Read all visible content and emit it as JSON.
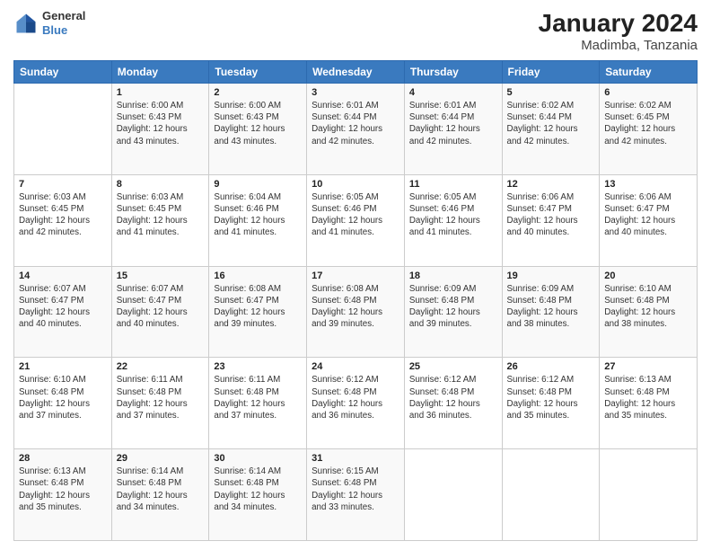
{
  "header": {
    "title": "January 2024",
    "subtitle": "Madimba, Tanzania",
    "logo_general": "General",
    "logo_blue": "Blue"
  },
  "weekdays": [
    "Sunday",
    "Monday",
    "Tuesday",
    "Wednesday",
    "Thursday",
    "Friday",
    "Saturday"
  ],
  "weeks": [
    [
      {
        "day": "",
        "sunrise": "",
        "sunset": "",
        "daylight": ""
      },
      {
        "day": "1",
        "sunrise": "Sunrise: 6:00 AM",
        "sunset": "Sunset: 6:43 PM",
        "daylight": "Daylight: 12 hours and 43 minutes."
      },
      {
        "day": "2",
        "sunrise": "Sunrise: 6:00 AM",
        "sunset": "Sunset: 6:43 PM",
        "daylight": "Daylight: 12 hours and 43 minutes."
      },
      {
        "day": "3",
        "sunrise": "Sunrise: 6:01 AM",
        "sunset": "Sunset: 6:44 PM",
        "daylight": "Daylight: 12 hours and 42 minutes."
      },
      {
        "day": "4",
        "sunrise": "Sunrise: 6:01 AM",
        "sunset": "Sunset: 6:44 PM",
        "daylight": "Daylight: 12 hours and 42 minutes."
      },
      {
        "day": "5",
        "sunrise": "Sunrise: 6:02 AM",
        "sunset": "Sunset: 6:44 PM",
        "daylight": "Daylight: 12 hours and 42 minutes."
      },
      {
        "day": "6",
        "sunrise": "Sunrise: 6:02 AM",
        "sunset": "Sunset: 6:45 PM",
        "daylight": "Daylight: 12 hours and 42 minutes."
      }
    ],
    [
      {
        "day": "7",
        "sunrise": "Sunrise: 6:03 AM",
        "sunset": "Sunset: 6:45 PM",
        "daylight": "Daylight: 12 hours and 42 minutes."
      },
      {
        "day": "8",
        "sunrise": "Sunrise: 6:03 AM",
        "sunset": "Sunset: 6:45 PM",
        "daylight": "Daylight: 12 hours and 41 minutes."
      },
      {
        "day": "9",
        "sunrise": "Sunrise: 6:04 AM",
        "sunset": "Sunset: 6:46 PM",
        "daylight": "Daylight: 12 hours and 41 minutes."
      },
      {
        "day": "10",
        "sunrise": "Sunrise: 6:05 AM",
        "sunset": "Sunset: 6:46 PM",
        "daylight": "Daylight: 12 hours and 41 minutes."
      },
      {
        "day": "11",
        "sunrise": "Sunrise: 6:05 AM",
        "sunset": "Sunset: 6:46 PM",
        "daylight": "Daylight: 12 hours and 41 minutes."
      },
      {
        "day": "12",
        "sunrise": "Sunrise: 6:06 AM",
        "sunset": "Sunset: 6:47 PM",
        "daylight": "Daylight: 12 hours and 40 minutes."
      },
      {
        "day": "13",
        "sunrise": "Sunrise: 6:06 AM",
        "sunset": "Sunset: 6:47 PM",
        "daylight": "Daylight: 12 hours and 40 minutes."
      }
    ],
    [
      {
        "day": "14",
        "sunrise": "Sunrise: 6:07 AM",
        "sunset": "Sunset: 6:47 PM",
        "daylight": "Daylight: 12 hours and 40 minutes."
      },
      {
        "day": "15",
        "sunrise": "Sunrise: 6:07 AM",
        "sunset": "Sunset: 6:47 PM",
        "daylight": "Daylight: 12 hours and 40 minutes."
      },
      {
        "day": "16",
        "sunrise": "Sunrise: 6:08 AM",
        "sunset": "Sunset: 6:47 PM",
        "daylight": "Daylight: 12 hours and 39 minutes."
      },
      {
        "day": "17",
        "sunrise": "Sunrise: 6:08 AM",
        "sunset": "Sunset: 6:48 PM",
        "daylight": "Daylight: 12 hours and 39 minutes."
      },
      {
        "day": "18",
        "sunrise": "Sunrise: 6:09 AM",
        "sunset": "Sunset: 6:48 PM",
        "daylight": "Daylight: 12 hours and 39 minutes."
      },
      {
        "day": "19",
        "sunrise": "Sunrise: 6:09 AM",
        "sunset": "Sunset: 6:48 PM",
        "daylight": "Daylight: 12 hours and 38 minutes."
      },
      {
        "day": "20",
        "sunrise": "Sunrise: 6:10 AM",
        "sunset": "Sunset: 6:48 PM",
        "daylight": "Daylight: 12 hours and 38 minutes."
      }
    ],
    [
      {
        "day": "21",
        "sunrise": "Sunrise: 6:10 AM",
        "sunset": "Sunset: 6:48 PM",
        "daylight": "Daylight: 12 hours and 37 minutes."
      },
      {
        "day": "22",
        "sunrise": "Sunrise: 6:11 AM",
        "sunset": "Sunset: 6:48 PM",
        "daylight": "Daylight: 12 hours and 37 minutes."
      },
      {
        "day": "23",
        "sunrise": "Sunrise: 6:11 AM",
        "sunset": "Sunset: 6:48 PM",
        "daylight": "Daylight: 12 hours and 37 minutes."
      },
      {
        "day": "24",
        "sunrise": "Sunrise: 6:12 AM",
        "sunset": "Sunset: 6:48 PM",
        "daylight": "Daylight: 12 hours and 36 minutes."
      },
      {
        "day": "25",
        "sunrise": "Sunrise: 6:12 AM",
        "sunset": "Sunset: 6:48 PM",
        "daylight": "Daylight: 12 hours and 36 minutes."
      },
      {
        "day": "26",
        "sunrise": "Sunrise: 6:12 AM",
        "sunset": "Sunset: 6:48 PM",
        "daylight": "Daylight: 12 hours and 35 minutes."
      },
      {
        "day": "27",
        "sunrise": "Sunrise: 6:13 AM",
        "sunset": "Sunset: 6:48 PM",
        "daylight": "Daylight: 12 hours and 35 minutes."
      }
    ],
    [
      {
        "day": "28",
        "sunrise": "Sunrise: 6:13 AM",
        "sunset": "Sunset: 6:48 PM",
        "daylight": "Daylight: 12 hours and 35 minutes."
      },
      {
        "day": "29",
        "sunrise": "Sunrise: 6:14 AM",
        "sunset": "Sunset: 6:48 PM",
        "daylight": "Daylight: 12 hours and 34 minutes."
      },
      {
        "day": "30",
        "sunrise": "Sunrise: 6:14 AM",
        "sunset": "Sunset: 6:48 PM",
        "daylight": "Daylight: 12 hours and 34 minutes."
      },
      {
        "day": "31",
        "sunrise": "Sunrise: 6:15 AM",
        "sunset": "Sunset: 6:48 PM",
        "daylight": "Daylight: 12 hours and 33 minutes."
      },
      {
        "day": "",
        "sunrise": "",
        "sunset": "",
        "daylight": ""
      },
      {
        "day": "",
        "sunrise": "",
        "sunset": "",
        "daylight": ""
      },
      {
        "day": "",
        "sunrise": "",
        "sunset": "",
        "daylight": ""
      }
    ]
  ]
}
